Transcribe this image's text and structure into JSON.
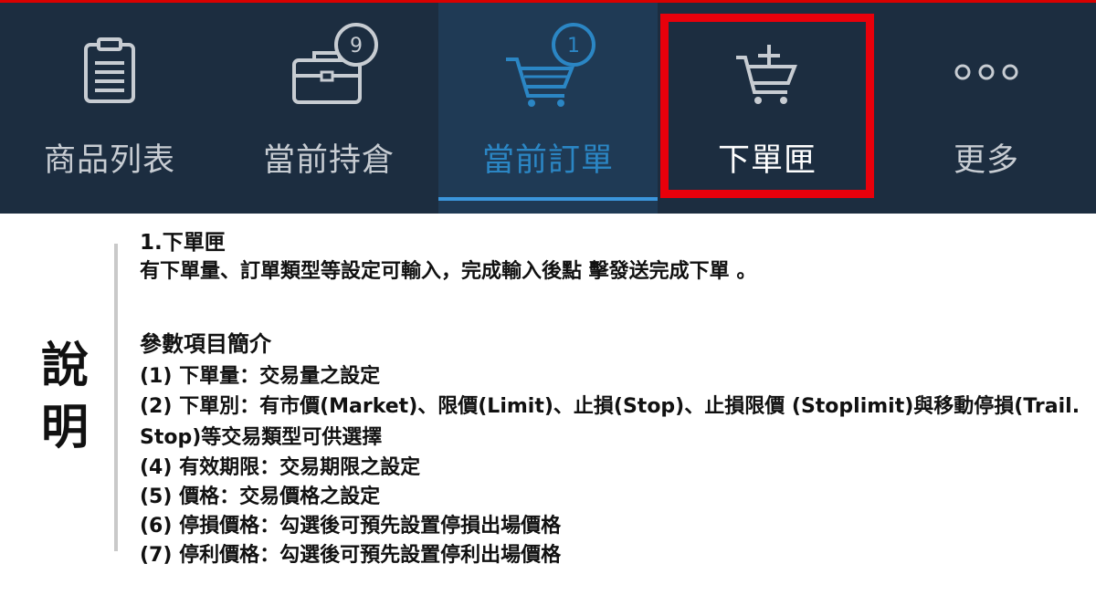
{
  "nav": {
    "tabs": [
      {
        "label": "商品列表",
        "icon": "clipboard-icon"
      },
      {
        "label": "當前持倉",
        "icon": "briefcase-icon",
        "badge": "9"
      },
      {
        "label": "當前訂單",
        "icon": "cart-icon",
        "badge": "1",
        "active": true
      },
      {
        "label": "下單匣",
        "icon": "cart-add-icon",
        "highlighted": true
      },
      {
        "label": "更多",
        "icon": "more-dots-icon",
        "dots": "ooo"
      }
    ],
    "accent_color": "#3b96dc",
    "highlight_color": "#e8000b"
  },
  "side_title": [
    "說",
    "明"
  ],
  "content": {
    "heading": "1.下單匣",
    "intro": "有下單量、訂單類型等設定可輸入，完成輸入後點 擊發送完成下單 。",
    "params_title": "參數項目簡介",
    "params": [
      "(1) 下單量：交易量之設定",
      "(2) 下單別：有市價(Market)、限價(Limit)、止損(Stop)、止損限價 (Stoplimit)與移動停損(Trail. Stop)等交易類型可供選擇",
      "(4) 有效期限：交易期限之設定",
      "(5) 價格：交易價格之設定",
      "(6) 停損價格：勾選後可預先設置停損出場價格",
      "(7) 停利價格：勾選後可預先設置停利出場價格"
    ]
  }
}
